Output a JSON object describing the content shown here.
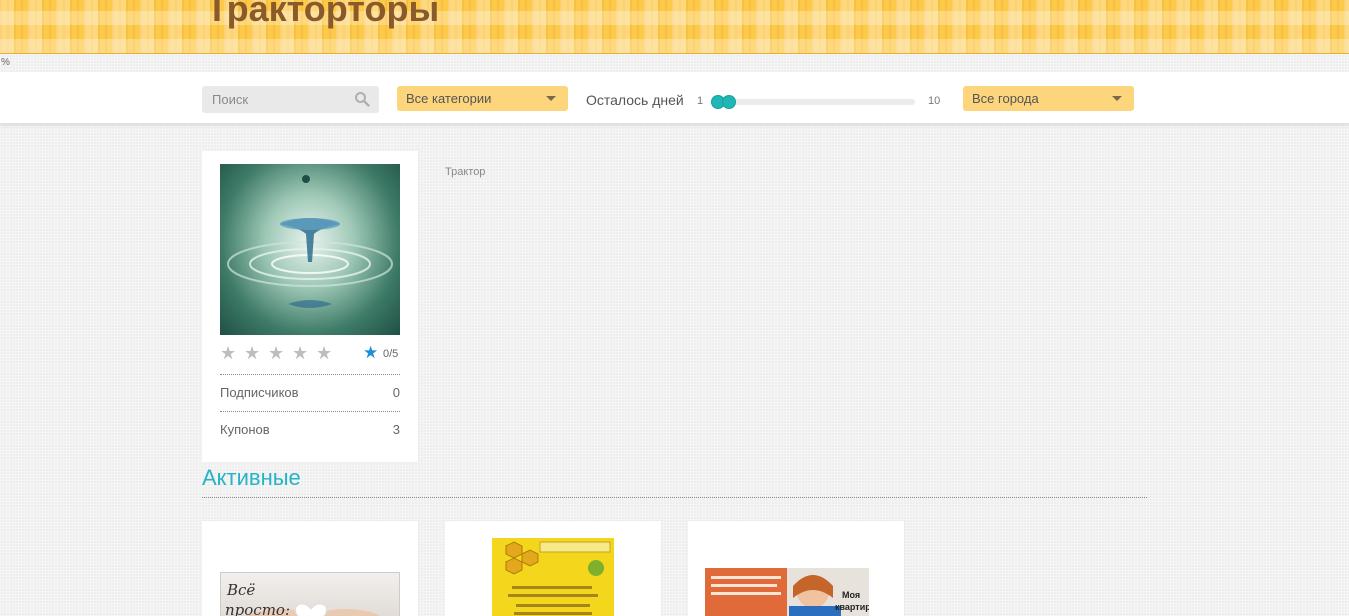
{
  "header": {
    "title": "Тракторторы",
    "percent_text": "%"
  },
  "filters": {
    "search_placeholder": "Поиск",
    "category_value": "Все категории",
    "days_label": "Осталось дней",
    "days_min": "1",
    "days_max": "10",
    "days_selected": [
      1,
      1
    ],
    "city_value": "Все города"
  },
  "profile": {
    "rating_text": "0/5",
    "subscribers_label": "Подписчиков",
    "subscribers_value": "0",
    "coupons_label": "Купонов",
    "coupons_value": "3",
    "tag": "Трактор"
  },
  "active_section": {
    "title": "Активные"
  },
  "colors": {
    "accent": "#27b3c7",
    "banner": "#fcc94a",
    "select_bg": "#fdd57c",
    "slider": "#1fb7b5",
    "rating_star": "#1e90d6"
  }
}
